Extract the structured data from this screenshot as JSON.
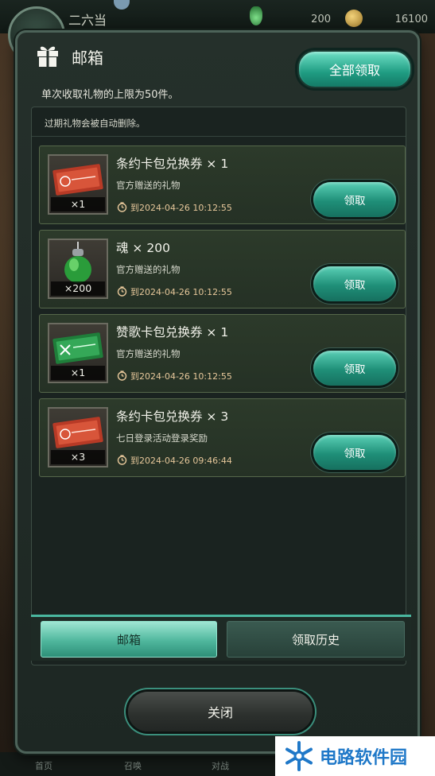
{
  "background": {
    "player_name": "二六当",
    "souls": "200",
    "gold": "16100",
    "nav": [
      "首页",
      "召唤",
      "对战"
    ]
  },
  "dialog": {
    "title": "邮箱",
    "collect_all_label": "全部领取",
    "limit_note": "单次收取礼物的上限为50件。",
    "expire_note": "过期礼物会被自动删除。",
    "items": [
      {
        "name": "条约卡包兑换券 × 1",
        "qty": "×1",
        "desc": "官方赠送的礼物",
        "expire": "到2024-04-26 10:12:55",
        "claim_label": "领取",
        "icon": "red-ticket-icon"
      },
      {
        "name": "魂 × 200",
        "qty": "×200",
        "desc": "官方赠送的礼物",
        "expire": "到2024-04-26 10:12:55",
        "claim_label": "领取",
        "icon": "green-soul-jar-icon"
      },
      {
        "name": "赞歌卡包兑换券 × 1",
        "qty": "×1",
        "desc": "官方赠送的礼物",
        "expire": "到2024-04-26 10:12:55",
        "claim_label": "领取",
        "icon": "green-ticket-icon"
      },
      {
        "name": "条约卡包兑换券 × 3",
        "qty": "×3",
        "desc": "七日登录活动登录奖励",
        "expire": "到2024-04-26 09:46:44",
        "claim_label": "领取",
        "icon": "red-ticket-icon"
      }
    ],
    "tabs": {
      "mailbox": "邮箱",
      "history": "领取历史"
    },
    "close_label": "关闭"
  },
  "watermark": {
    "text": "电路软件园"
  },
  "colors": {
    "accent": "#2fb59a",
    "expire_text": "#e6c79a",
    "ticket_red": "#c0402a",
    "ticket_green": "#2c9a4a"
  }
}
